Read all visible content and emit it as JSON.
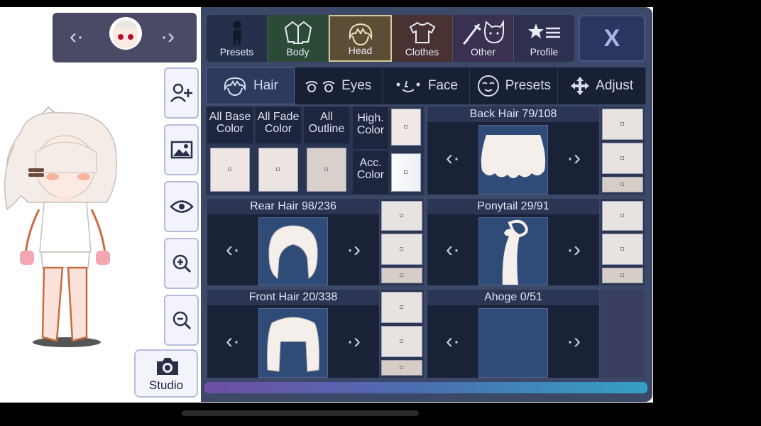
{
  "nav": {
    "prev": "‹·",
    "next": "·›"
  },
  "categories": [
    {
      "key": "presets",
      "label": "Presets",
      "icon": "silhouette-icon"
    },
    {
      "key": "body",
      "label": "Body",
      "icon": "jacket-icon"
    },
    {
      "key": "head",
      "label": "Head",
      "icon": "hair-icon",
      "selected": true
    },
    {
      "key": "clothes",
      "label": "Clothes",
      "icon": "shirt-icon"
    },
    {
      "key": "other",
      "label": "Other",
      "icon": "sword-cat-icon"
    },
    {
      "key": "profile",
      "label": "Profile",
      "icon": "star-list-icon"
    }
  ],
  "close_label": "X",
  "subtabs": [
    {
      "label": "Hair",
      "selected": true
    },
    {
      "label": "Eyes"
    },
    {
      "label": "Face"
    },
    {
      "label": "Presets"
    },
    {
      "label": "Adjust"
    }
  ],
  "colors": {
    "all_base": "All Base Color",
    "all_fade": "All Fade Color",
    "all_outline": "All Outline",
    "high": "High. Color",
    "acc": "Acc. Color"
  },
  "parts": {
    "back_hair": "Back Hair 79/108",
    "rear_hair": "Rear Hair 98/236",
    "ponytail": "Ponytail 29/91",
    "front_hair": "Front Hair 20/338",
    "ahoge": "Ahoge 0/51"
  },
  "studio_label": "Studio",
  "palette": {
    "panel": "#3b4868",
    "dark": "#1a2238",
    "accent": "#d7c896",
    "swatch": "#e8e2e0"
  }
}
